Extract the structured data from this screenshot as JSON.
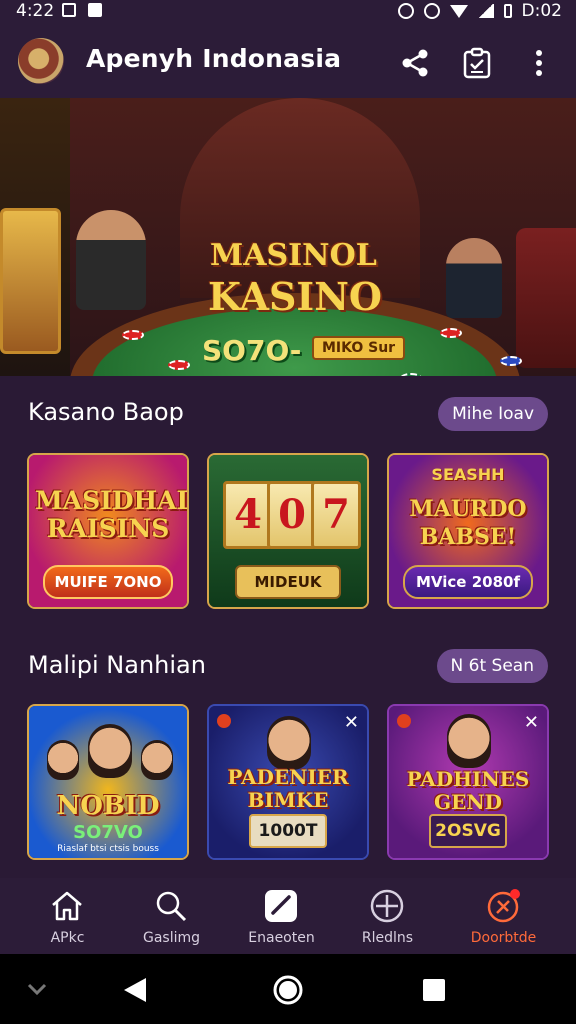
{
  "status_bar": {
    "time": "4:22",
    "right_text": "D:02"
  },
  "app_bar": {
    "title": "Apenyh Indonasia",
    "icons": [
      "share-icon",
      "clipboard-icon",
      "more-vert-icon"
    ]
  },
  "hero": {
    "brand_top": "MASINOL",
    "brand_main": "KASINO",
    "jackpot": "SO7O-",
    "jackpot_tag": "MIKO Sur"
  },
  "section1": {
    "title": "Kasano Baop",
    "action": "Mihe Ioav",
    "cards": [
      {
        "title": "MASIDHAI RAISINS",
        "button": "MUIFE 7ONO",
        "colors": [
          "#b81a6e",
          "#f08a1e"
        ]
      },
      {
        "reels": [
          "4",
          "0",
          "7"
        ],
        "button": "MIDEUK",
        "colors": [
          "#1f5a2c",
          "#0f3a1a"
        ]
      },
      {
        "title_top": "SEASHH",
        "title": "MAURDO BABSE!",
        "button": "MVice 2080f",
        "colors": [
          "#6a1a8a",
          "#f06a1e"
        ]
      }
    ]
  },
  "section2": {
    "title": "Malipi Nanhian",
    "action": "N 6t Sean",
    "cards": [
      {
        "title": "NOBID",
        "subtitle": "SO7VO",
        "caption": "Riaslaf btsi ctsis bouss",
        "colors": [
          "#1a5ad0",
          "#f0b61e"
        ]
      },
      {
        "title": "PADENIER BIMKE",
        "button": "1000T",
        "colors": [
          "#1a1e6a",
          "#3a4ab0"
        ]
      },
      {
        "title": "PADHINES GEND",
        "button": "2OSVG",
        "colors": [
          "#5a1a7a",
          "#b03ab0"
        ]
      }
    ]
  },
  "bottom_nav": [
    {
      "label": "APkc",
      "icon": "home-icon"
    },
    {
      "label": "Gaslimg",
      "icon": "search-icon"
    },
    {
      "label": "Enaeoten",
      "icon": "check-badge-icon"
    },
    {
      "label": "Rledlns",
      "icon": "compass-icon"
    },
    {
      "label": "Doorbtde",
      "icon": "target-icon",
      "active": true
    }
  ],
  "colors": {
    "background": "#2a1a35",
    "bar": "#2c1c38",
    "pill": "#6c4a8c",
    "accent": "#ff6a3a",
    "gold": "#f7d350"
  }
}
